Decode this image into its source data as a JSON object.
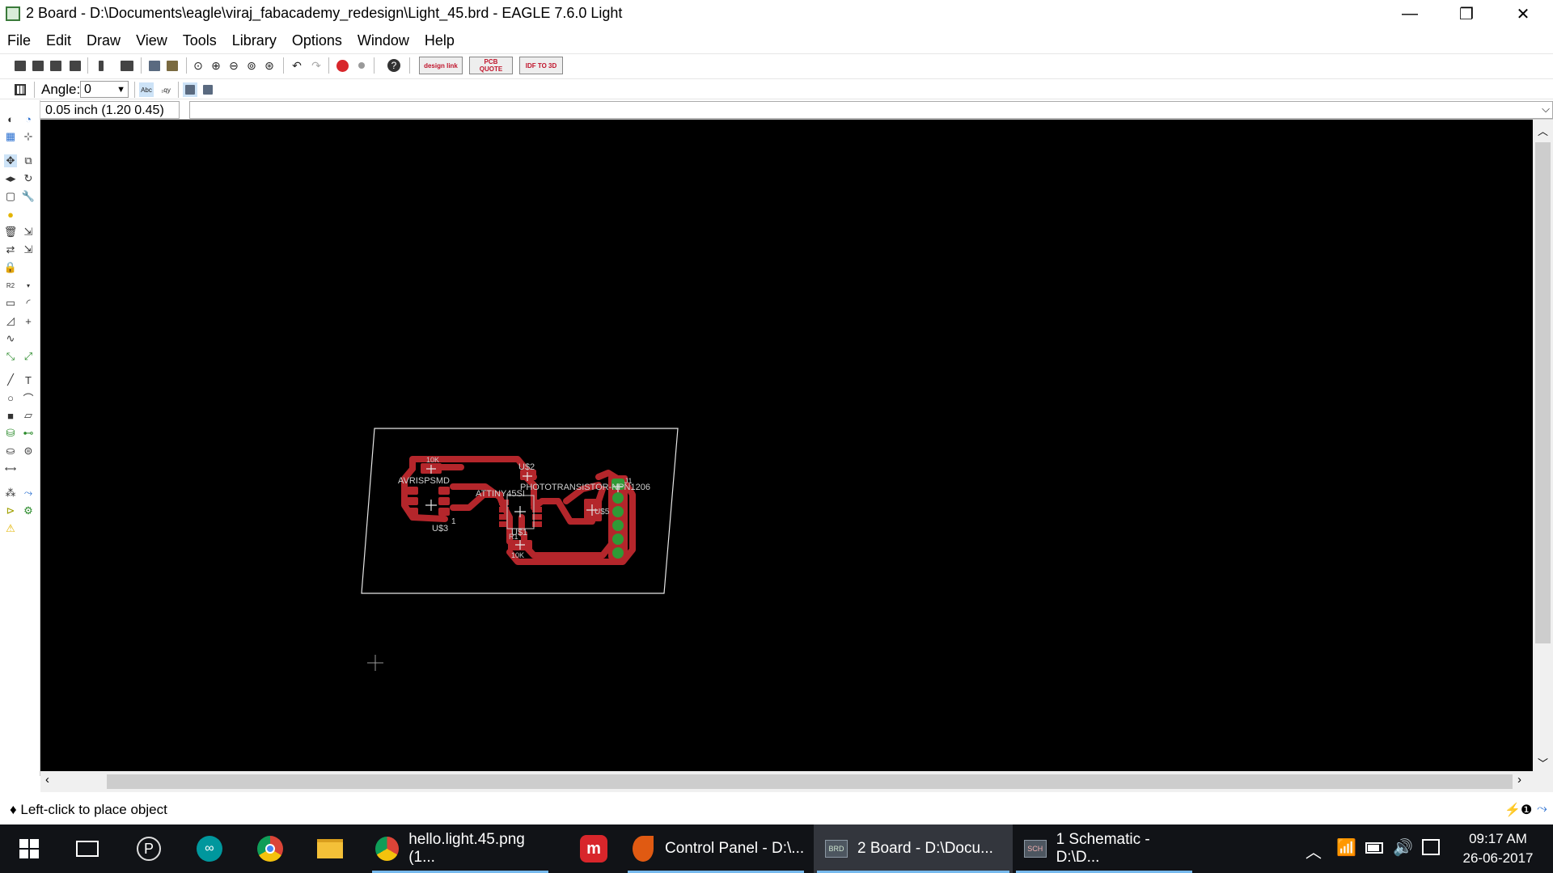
{
  "window": {
    "title": "2 Board - D:\\Documents\\eagle\\viraj_fabacademy_redesign\\Light_45.brd - EAGLE 7.6.0 Light",
    "minimize": "—",
    "maximize": "❐",
    "close": "✕"
  },
  "menu": [
    "File",
    "Edit",
    "Draw",
    "View",
    "Tools",
    "Library",
    "Options",
    "Window",
    "Help"
  ],
  "toolbar": {
    "badges": [
      {
        "label": "design link",
        "icon": "design-link-icon"
      },
      {
        "label": "PCB QUOTE",
        "icon": "pcb-quote-icon"
      },
      {
        "label": "IDF TO 3D",
        "icon": "idf-to-3d-icon"
      }
    ]
  },
  "params": {
    "angle_label": "Angle:",
    "angle_value": "0"
  },
  "coordinates": "0.05 inch (1.20 0.45)",
  "board": {
    "labels": {
      "r_top_value": "10K",
      "header_name": "AVRISPSMD",
      "header_part": "U$3",
      "header_pin1": "1",
      "cap_name": "U$2",
      "ic_name": "ATTINY45SI",
      "ic_part": "U$1",
      "photo_name": "PHOTOTRANSISTOR-NPN1206",
      "photo_part": "U$5",
      "ftdi_name": "J1",
      "r_bottom_name": "R1",
      "r_bottom_value": "10K"
    }
  },
  "status": {
    "message": "♦ Left-click to place object"
  },
  "taskbar": {
    "apps": [
      {
        "label": "hello.light.45.png (1...",
        "icon": "chrome-icon"
      },
      {
        "label": "Control Panel - D:\\...",
        "icon": "fabmodules-icon"
      },
      {
        "label": "2 Board - D:\\Docu...",
        "icon": "eagle-board-icon"
      },
      {
        "label": "1 Schematic - D:\\D...",
        "icon": "eagle-schematic-icon"
      }
    ],
    "time": "09:17 AM",
    "date": "26-06-2017"
  },
  "colors": {
    "canvas": "#000000",
    "copper": "#b4262b",
    "pad_green": "#2f9a36",
    "dimension": "#e6e6e6",
    "taskbar": "#111317"
  }
}
